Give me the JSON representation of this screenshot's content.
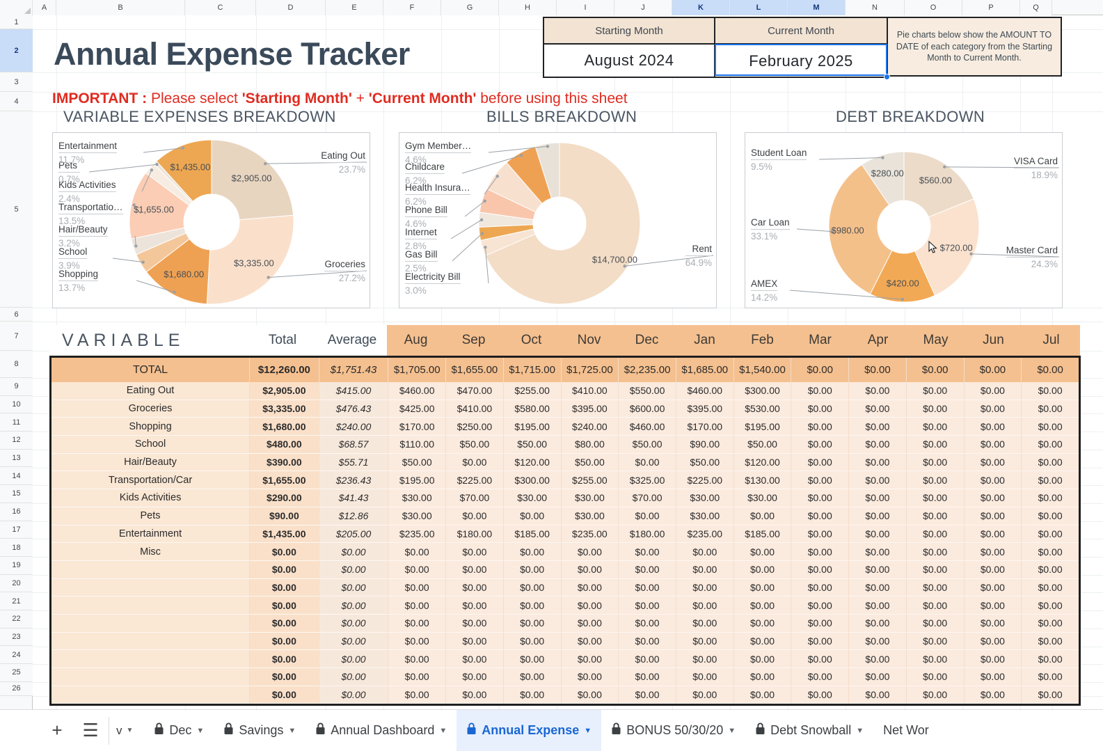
{
  "spreadsheet": {
    "columns": [
      "A",
      "B",
      "C",
      "D",
      "E",
      "F",
      "G",
      "H",
      "I",
      "J",
      "K",
      "L",
      "M",
      "N",
      "O",
      "P",
      "Q"
    ],
    "selected_columns": [
      "K",
      "L",
      "M"
    ],
    "row_numbers": [
      "1",
      "2",
      "3",
      "4",
      "5",
      "6",
      "7",
      "8",
      "9",
      "10",
      "11",
      "12",
      "13",
      "14",
      "15",
      "16",
      "17",
      "18",
      "19",
      "20",
      "21",
      "22",
      "23",
      "24",
      "25",
      "26"
    ],
    "selected_row": "2"
  },
  "header": {
    "title": "Annual Expense Tracker",
    "important_prefix": "IMPORTANT : ",
    "important_text_1": "Please select ",
    "important_bold_1": "'Starting Month'",
    "important_plus": " + ",
    "important_bold_2": "'Current Month'",
    "important_text_2": " before using this sheet"
  },
  "month_selectors": {
    "starting": {
      "label": "Starting Month",
      "value": "August  2024"
    },
    "current": {
      "label": "Current Month",
      "value": "February  2025"
    },
    "note": "Pie charts below show the AMOUNT TO DATE of each category from the Starting Month to Current Month."
  },
  "chart_data": [
    {
      "type": "pie",
      "title": "VARIABLE EXPENSES BREAKDOWN",
      "labels": [
        "Eating Out",
        "Groceries",
        "Shopping",
        "School",
        "Hair/Beauty",
        "Transportatio…",
        "Kids Activities",
        "Pets",
        "Entertainment"
      ],
      "values": [
        2905.0,
        3335.0,
        1680.0,
        480.0,
        390.0,
        1655.0,
        290.0,
        90.0,
        1435.0
      ],
      "value_labels": [
        "$2,905.00",
        "$3,335.00",
        "$1,680.00",
        "",
        "",
        "$1,655.00",
        "",
        "",
        "$1,435.00"
      ],
      "percents": [
        "23.7%",
        "27.2%",
        "13.7%",
        "3.9%",
        "3.2%",
        "13.5%",
        "2.4%",
        "0.7%",
        "11.7%"
      ],
      "colors": [
        "#e8d5c0",
        "#fae0cb",
        "#efa153",
        "#f4c79a",
        "#ece4da",
        "#fbcdb4",
        "#f6ece2",
        "#ece4da",
        "#eda752"
      ],
      "legend_position": "callout"
    },
    {
      "type": "pie",
      "title": "BILLS BREAKDOWN",
      "labels": [
        "Rent",
        "Electricity Bill",
        "Gas Bill",
        "Internet",
        "Phone Bill",
        "Health Insura…",
        "Childcare",
        "Gym Member…"
      ],
      "values": [
        14700.0,
        680.0,
        566.0,
        634.0,
        1042.0,
        1404.0,
        1404.0,
        1042.0
      ],
      "value_labels": [
        "$14,700.00",
        "",
        "",
        "",
        "",
        "",
        "",
        ""
      ],
      "percents": [
        "64.9%",
        "3.0%",
        "2.5%",
        "2.8%",
        "4.6%",
        "6.2%",
        "6.2%",
        "4.6%"
      ],
      "colors": [
        "#f3ddc6",
        "#f7e4d3",
        "#eda752",
        "#f0e7dd",
        "#f9c6ac",
        "#f7e0cd",
        "#efa153",
        "#e8e1d8"
      ],
      "legend_position": "callout"
    },
    {
      "type": "pie",
      "title": "DEBT BREAKDOWN",
      "labels": [
        "VISA Card",
        "Master Card",
        "AMEX",
        "Car Loan",
        "Student Loan"
      ],
      "values": [
        560.0,
        720.0,
        420.0,
        980.0,
        280.0
      ],
      "value_labels": [
        "$560.00",
        "$720.00",
        "$420.00",
        "$980.00",
        "$280.00"
      ],
      "percents": [
        "18.9%",
        "24.3%",
        "14.2%",
        "33.1%",
        "9.5%"
      ],
      "colors": [
        "#ecdbc8",
        "#fae2ce",
        "#f2a955",
        "#f4c08a",
        "#e9e3da"
      ],
      "legend_position": "callout"
    }
  ],
  "table": {
    "section_label": "VARIABLE",
    "col_total": "Total",
    "col_average": "Average",
    "months": [
      "Aug",
      "Sep",
      "Oct",
      "Nov",
      "Dec",
      "Jan",
      "Feb",
      "Mar",
      "Apr",
      "May",
      "Jun",
      "Jul"
    ],
    "total_row": {
      "label": "TOTAL",
      "total": "$12,260.00",
      "average": "$1,751.43",
      "months": [
        "$1,705.00",
        "$1,655.00",
        "$1,715.00",
        "$1,725.00",
        "$2,235.00",
        "$1,685.00",
        "$1,540.00",
        "$0.00",
        "$0.00",
        "$0.00",
        "$0.00",
        "$0.00"
      ]
    },
    "rows": [
      {
        "label": "Eating Out",
        "total": "$2,905.00",
        "average": "$415.00",
        "months": [
          "$460.00",
          "$470.00",
          "$255.00",
          "$410.00",
          "$550.00",
          "$460.00",
          "$300.00",
          "$0.00",
          "$0.00",
          "$0.00",
          "$0.00",
          "$0.00"
        ]
      },
      {
        "label": "Groceries",
        "total": "$3,335.00",
        "average": "$476.43",
        "months": [
          "$425.00",
          "$410.00",
          "$580.00",
          "$395.00",
          "$600.00",
          "$395.00",
          "$530.00",
          "$0.00",
          "$0.00",
          "$0.00",
          "$0.00",
          "$0.00"
        ]
      },
      {
        "label": "Shopping",
        "total": "$1,680.00",
        "average": "$240.00",
        "months": [
          "$170.00",
          "$250.00",
          "$195.00",
          "$240.00",
          "$460.00",
          "$170.00",
          "$195.00",
          "$0.00",
          "$0.00",
          "$0.00",
          "$0.00",
          "$0.00"
        ]
      },
      {
        "label": "School",
        "total": "$480.00",
        "average": "$68.57",
        "months": [
          "$110.00",
          "$50.00",
          "$50.00",
          "$80.00",
          "$50.00",
          "$90.00",
          "$50.00",
          "$0.00",
          "$0.00",
          "$0.00",
          "$0.00",
          "$0.00"
        ]
      },
      {
        "label": "Hair/Beauty",
        "total": "$390.00",
        "average": "$55.71",
        "months": [
          "$50.00",
          "$0.00",
          "$120.00",
          "$50.00",
          "$0.00",
          "$50.00",
          "$120.00",
          "$0.00",
          "$0.00",
          "$0.00",
          "$0.00",
          "$0.00"
        ]
      },
      {
        "label": "Transportation/Car",
        "total": "$1,655.00",
        "average": "$236.43",
        "months": [
          "$195.00",
          "$225.00",
          "$300.00",
          "$255.00",
          "$325.00",
          "$225.00",
          "$130.00",
          "$0.00",
          "$0.00",
          "$0.00",
          "$0.00",
          "$0.00"
        ]
      },
      {
        "label": "Kids Activities",
        "total": "$290.00",
        "average": "$41.43",
        "months": [
          "$30.00",
          "$70.00",
          "$30.00",
          "$30.00",
          "$70.00",
          "$30.00",
          "$30.00",
          "$0.00",
          "$0.00",
          "$0.00",
          "$0.00",
          "$0.00"
        ]
      },
      {
        "label": "Pets",
        "total": "$90.00",
        "average": "$12.86",
        "months": [
          "$30.00",
          "$0.00",
          "$0.00",
          "$30.00",
          "$0.00",
          "$30.00",
          "$0.00",
          "$0.00",
          "$0.00",
          "$0.00",
          "$0.00",
          "$0.00"
        ]
      },
      {
        "label": "Entertainment",
        "total": "$1,435.00",
        "average": "$205.00",
        "months": [
          "$235.00",
          "$180.00",
          "$185.00",
          "$235.00",
          "$180.00",
          "$235.00",
          "$185.00",
          "$0.00",
          "$0.00",
          "$0.00",
          "$0.00",
          "$0.00"
        ]
      },
      {
        "label": "Misc",
        "total": "$0.00",
        "average": "$0.00",
        "months": [
          "$0.00",
          "$0.00",
          "$0.00",
          "$0.00",
          "$0.00",
          "$0.00",
          "$0.00",
          "$0.00",
          "$0.00",
          "$0.00",
          "$0.00",
          "$0.00"
        ]
      },
      {
        "label": "",
        "total": "$0.00",
        "average": "$0.00",
        "months": [
          "$0.00",
          "$0.00",
          "$0.00",
          "$0.00",
          "$0.00",
          "$0.00",
          "$0.00",
          "$0.00",
          "$0.00",
          "$0.00",
          "$0.00",
          "$0.00"
        ]
      },
      {
        "label": "",
        "total": "$0.00",
        "average": "$0.00",
        "months": [
          "$0.00",
          "$0.00",
          "$0.00",
          "$0.00",
          "$0.00",
          "$0.00",
          "$0.00",
          "$0.00",
          "$0.00",
          "$0.00",
          "$0.00",
          "$0.00"
        ]
      },
      {
        "label": "",
        "total": "$0.00",
        "average": "$0.00",
        "months": [
          "$0.00",
          "$0.00",
          "$0.00",
          "$0.00",
          "$0.00",
          "$0.00",
          "$0.00",
          "$0.00",
          "$0.00",
          "$0.00",
          "$0.00",
          "$0.00"
        ]
      },
      {
        "label": "",
        "total": "$0.00",
        "average": "$0.00",
        "months": [
          "$0.00",
          "$0.00",
          "$0.00",
          "$0.00",
          "$0.00",
          "$0.00",
          "$0.00",
          "$0.00",
          "$0.00",
          "$0.00",
          "$0.00",
          "$0.00"
        ]
      },
      {
        "label": "",
        "total": "$0.00",
        "average": "$0.00",
        "months": [
          "$0.00",
          "$0.00",
          "$0.00",
          "$0.00",
          "$0.00",
          "$0.00",
          "$0.00",
          "$0.00",
          "$0.00",
          "$0.00",
          "$0.00",
          "$0.00"
        ]
      },
      {
        "label": "",
        "total": "$0.00",
        "average": "$0.00",
        "months": [
          "$0.00",
          "$0.00",
          "$0.00",
          "$0.00",
          "$0.00",
          "$0.00",
          "$0.00",
          "$0.00",
          "$0.00",
          "$0.00",
          "$0.00",
          "$0.00"
        ]
      },
      {
        "label": "",
        "total": "$0.00",
        "average": "$0.00",
        "months": [
          "$0.00",
          "$0.00",
          "$0.00",
          "$0.00",
          "$0.00",
          "$0.00",
          "$0.00",
          "$0.00",
          "$0.00",
          "$0.00",
          "$0.00",
          "$0.00"
        ]
      },
      {
        "label": "",
        "total": "$0.00",
        "average": "$0.00",
        "months": [
          "$0.00",
          "$0.00",
          "$0.00",
          "$0.00",
          "$0.00",
          "$0.00",
          "$0.00",
          "$0.00",
          "$0.00",
          "$0.00",
          "$0.00",
          "$0.00"
        ]
      }
    ]
  },
  "tabbar": {
    "add_label": "+",
    "all_sheets_label": "☰",
    "filter_value": "v",
    "tabs": [
      {
        "label": "Dec",
        "locked": true,
        "active": false
      },
      {
        "label": "Savings",
        "locked": true,
        "active": false
      },
      {
        "label": "Annual Dashboard",
        "locked": true,
        "active": false
      },
      {
        "label": "Annual Expense",
        "locked": true,
        "active": true
      },
      {
        "label": "BONUS 50/30/20",
        "locked": true,
        "active": false
      },
      {
        "label": "Debt Snowball",
        "locked": true,
        "active": false
      },
      {
        "label": "Net Wor",
        "locked": false,
        "active": false
      }
    ]
  },
  "colors": {
    "accent_orange": "#f5c08f",
    "row_tint": "#fbeade",
    "cat_tint": "#fae7d4",
    "title_blue": "#3b4a5a",
    "warning_red": "#e02b20",
    "selection_blue": "#1a73e8"
  }
}
